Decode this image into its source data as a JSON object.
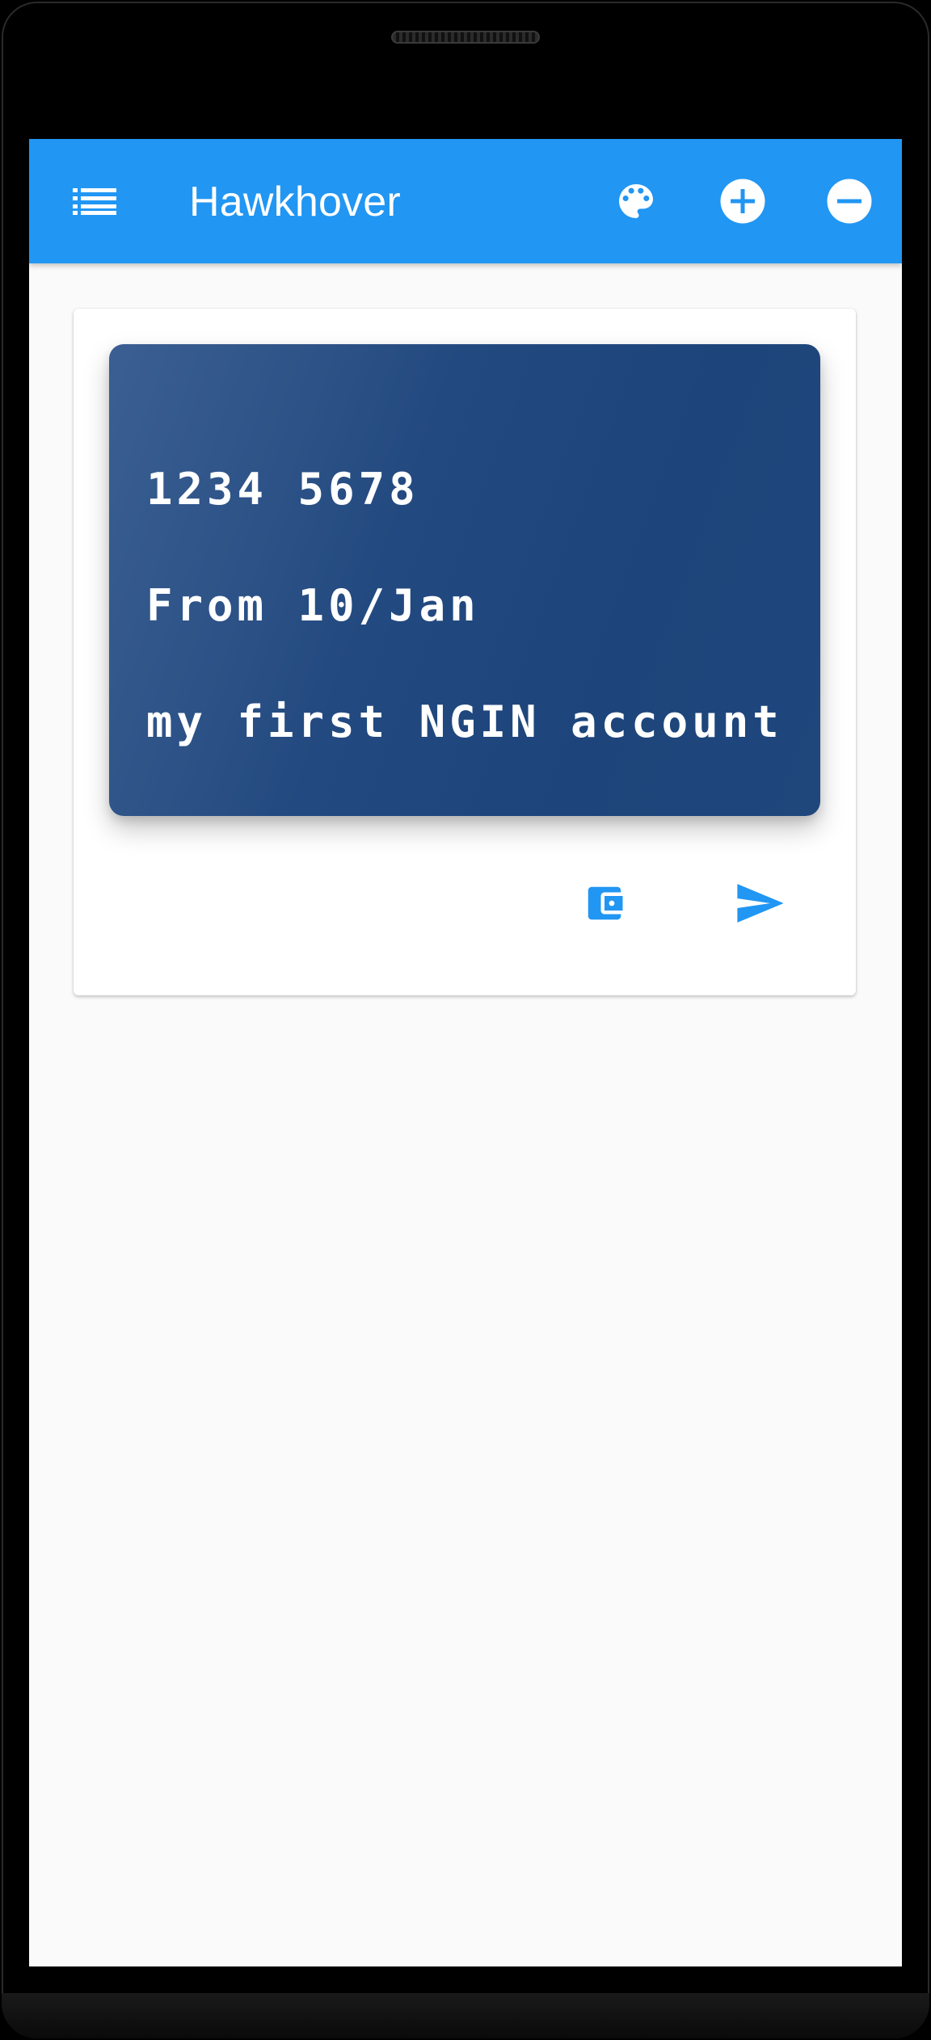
{
  "app": {
    "title": "Hawkhover"
  },
  "toolbar": {
    "menu_icon": "list-icon",
    "actions": [
      {
        "icon": "palette-icon"
      },
      {
        "icon": "add-circle-icon"
      },
      {
        "icon": "remove-circle-icon"
      }
    ]
  },
  "account_card": {
    "number": "1234 5678",
    "since": "From 10/Jan",
    "description": "my first NGIN account",
    "actions": [
      {
        "icon": "wallet-icon"
      },
      {
        "icon": "send-icon"
      }
    ]
  },
  "colors": {
    "primary": "#2196f3",
    "card_gradient_start": "#3b5f92",
    "card_gradient_end": "#1f477c",
    "background": "#fafafa",
    "text_on_primary": "#ffffff"
  }
}
